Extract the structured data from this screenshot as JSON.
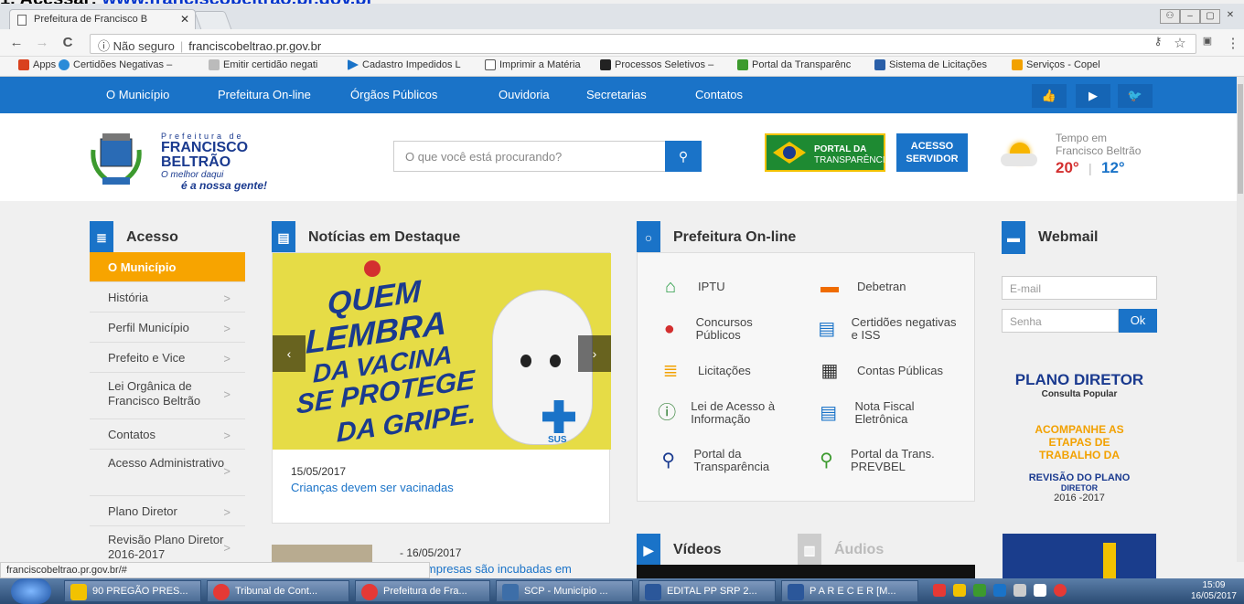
{
  "caption": {
    "prefix": "1. Acessar: ",
    "link": "www.franciscobeltrao.pr.gov.br"
  },
  "browser": {
    "tab_title": "Prefeitura de Francisco B",
    "back": "←",
    "forward": "→",
    "reload": "C",
    "security": "ⓘ Não seguro",
    "url": "franciscobeltrao.pr.gov.br",
    "bookmarks": [
      {
        "label": "Apps",
        "color": "#d9411e"
      },
      {
        "label": "Certidões Negativas –",
        "color": "#2a8bd8"
      },
      {
        "label": "Emitir certidão negati",
        "color": "#bbbbbb"
      },
      {
        "label": "Cadastro Impedidos L",
        "color": "#1a73c8"
      },
      {
        "label": "Imprimir a Matéria",
        "color": "#ffffff"
      },
      {
        "label": "Processos Seletivos –",
        "color": "#222222"
      },
      {
        "label": "Portal da Transparênc",
        "color": "#3c9a2e"
      },
      {
        "label": "Sistema de Licitações",
        "color": "#2a5fa8"
      },
      {
        "label": "Serviços - Copel",
        "color": "#f2a100"
      }
    ]
  },
  "nav": [
    "O Município",
    "Prefeitura On-line",
    "Órgãos Públicos",
    "Ouvidoria",
    "Secretarias",
    "Contatos"
  ],
  "social": [
    {
      "icon": "thumbs-up-icon",
      "glyph": "👍"
    },
    {
      "icon": "play-icon",
      "glyph": "▶"
    },
    {
      "icon": "twitter-icon",
      "glyph": "🐦"
    }
  ],
  "logo": {
    "line1": "Prefeitura de",
    "line2": "FRANCISCO",
    "line3": "BELTRÃO",
    "line4": "O melhor daqui",
    "line5": "é a nossa gente!"
  },
  "search": {
    "placeholder": "O que você está procurando?"
  },
  "portal": {
    "line1": "PORTAL DA",
    "line2": "TRANSPARÊNCIA"
  },
  "acesso": {
    "line1": "ACESSO",
    "line2": "SERVIDOR"
  },
  "weather": {
    "label1": "Tempo em",
    "label2": "Francisco Beltrão",
    "max": "20°",
    "sep": "|",
    "min": "12°"
  },
  "menu": {
    "title": "Acesso",
    "items": [
      {
        "label": "O Município",
        "active": true
      },
      {
        "label": "História"
      },
      {
        "label": "Perfil Município"
      },
      {
        "label": "Prefeito e Vice"
      },
      {
        "label": "Lei Orgânica de Francisco Beltrão",
        "tall": true
      },
      {
        "label": "Contatos"
      },
      {
        "label": "Acesso Administrativo",
        "tall": true
      },
      {
        "label": "Plano Diretor"
      },
      {
        "label": "Revisão Plano Diretor 2016-2017",
        "tall": true
      }
    ]
  },
  "news": {
    "title": "Notícias em Destaque",
    "banner": [
      "QUEM",
      "LEMBRA",
      "DA VACINA",
      "SE PROTEGE",
      "DA GRIPE."
    ],
    "sus": "SUS",
    "date": "15/05/2017",
    "headline": "Crianças devem ser vacinadas",
    "date2": "- 16/05/2017",
    "headline2": "ras empresas são incubadas em"
  },
  "online": {
    "title": "Prefeitura On-line",
    "items": [
      {
        "label": "IPTU",
        "icon": "house-icon",
        "glyph": "⌂",
        "color": "#2e9e4a"
      },
      {
        "label": "Debetran",
        "icon": "car-icon",
        "glyph": "🚗",
        "color": "#ef6c00"
      },
      {
        "label": "Concursos Públicos",
        "icon": "person-icon",
        "glyph": "●",
        "color": "#d32f2f"
      },
      {
        "label": "Certidões negativas e ISS",
        "icon": "document-icon",
        "glyph": "▤",
        "color": "#1a73c8"
      },
      {
        "label": "Licitações",
        "icon": "list-icon",
        "glyph": "≣",
        "color": "#f2a100"
      },
      {
        "label": "Contas Públicas",
        "icon": "calculator-icon",
        "glyph": "▦",
        "color": "#333333"
      },
      {
        "label": "Lei de Acesso à Informação",
        "icon": "info-icon",
        "glyph": "ⓘ",
        "color": "#2e7d32"
      },
      {
        "label": "Nota Fiscal Eletrônica",
        "icon": "invoice-icon",
        "glyph": "▤",
        "color": "#1a73c8"
      },
      {
        "label": "Portal da Transparência",
        "icon": "search-icon",
        "glyph": "⚲",
        "color": "#1a3a8f"
      },
      {
        "label": "Portal da Trans. PREVBEL",
        "icon": "location-search-icon",
        "glyph": "⚲",
        "color": "#3c9a2e"
      }
    ]
  },
  "webmail": {
    "title": "Webmail",
    "email_placeholder": "E-mail",
    "password_placeholder": "Senha",
    "ok": "Ok"
  },
  "plano": {
    "title": "PLANO DIRETOR",
    "sub": "Consulta Popular",
    "l1": "ACOMPANHE AS",
    "l2": "ETAPAS DE",
    "l3": "TRABALHO DA",
    "l4": "REVISÃO DO PLANO",
    "l5": "DIRETOR",
    "l6": "2016 -2017"
  },
  "videos": {
    "tab1": "Vídeos",
    "tab2": "Áudios"
  },
  "status_url": "franciscobeltrao.pr.gov.br/#",
  "taskbar": [
    {
      "label": "90 PREGÃO PRES...",
      "color": "#f2c200"
    },
    {
      "label": "Tribunal de Cont...",
      "color": "#e53935"
    },
    {
      "label": "Prefeitura de Fra...",
      "color": "#e53935"
    },
    {
      "label": "SCP - Município ...",
      "color": "#3d6ea8"
    },
    {
      "label": "EDITAL PP SRP 2...",
      "color": "#2b579a"
    },
    {
      "label": "P A R E C E R [M...",
      "color": "#2b579a"
    }
  ],
  "clock": {
    "time": "15:09",
    "date": "16/05/2017"
  }
}
